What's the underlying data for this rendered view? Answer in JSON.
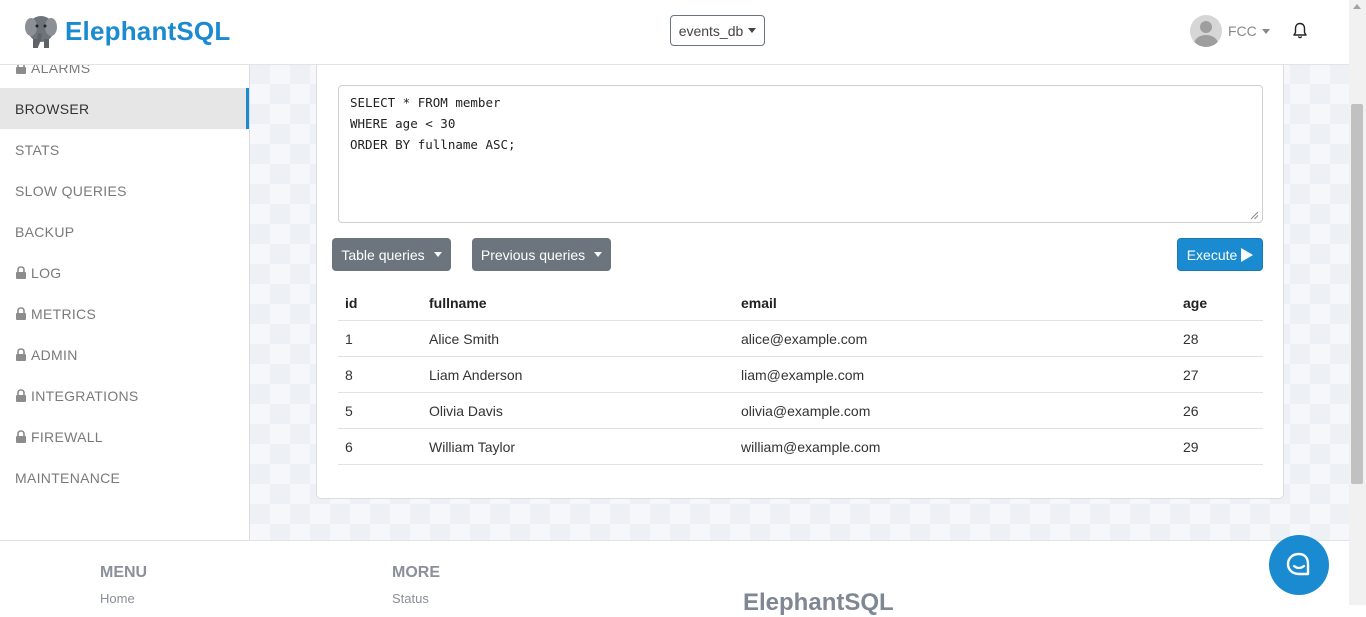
{
  "brand": {
    "name": "ElephantSQL"
  },
  "header": {
    "database": "events_db",
    "user": "FCC"
  },
  "sidebar": {
    "items": [
      {
        "label": "ALARMS",
        "locked": true
      },
      {
        "label": "BROWSER",
        "locked": false,
        "active": true
      },
      {
        "label": "STATS",
        "locked": false
      },
      {
        "label": "SLOW QUERIES",
        "locked": false
      },
      {
        "label": "BACKUP",
        "locked": false
      },
      {
        "label": "LOG",
        "locked": true
      },
      {
        "label": "METRICS",
        "locked": true
      },
      {
        "label": "ADMIN",
        "locked": true
      },
      {
        "label": "INTEGRATIONS",
        "locked": true
      },
      {
        "label": "FIREWALL",
        "locked": true
      },
      {
        "label": "MAINTENANCE",
        "locked": false
      }
    ]
  },
  "editor": {
    "query": "SELECT * FROM member\nWHERE age < 30\nORDER BY fullname ASC;"
  },
  "toolbar": {
    "table_queries_label": "Table queries",
    "previous_queries_label": "Previous queries",
    "execute_label": "Execute"
  },
  "results": {
    "columns": [
      "id",
      "fullname",
      "email",
      "age"
    ],
    "rows": [
      [
        "1",
        "Alice Smith",
        "alice@example.com",
        "28"
      ],
      [
        "8",
        "Liam Anderson",
        "liam@example.com",
        "27"
      ],
      [
        "5",
        "Olivia Davis",
        "olivia@example.com",
        "26"
      ],
      [
        "6",
        "William Taylor",
        "william@example.com",
        "29"
      ]
    ]
  },
  "footer": {
    "menu_heading": "MENU",
    "menu_first_link": "Home",
    "more_heading": "MORE",
    "more_first_link": "Status",
    "brand": "ElephantSQL"
  },
  "colors": {
    "accent": "#1a8bd0",
    "button_gray": "#6c757d"
  },
  "icons": [
    "elephant-logo-icon",
    "caret-down-icon",
    "bell-icon",
    "lock-icon",
    "play-icon",
    "chat-icon"
  ]
}
